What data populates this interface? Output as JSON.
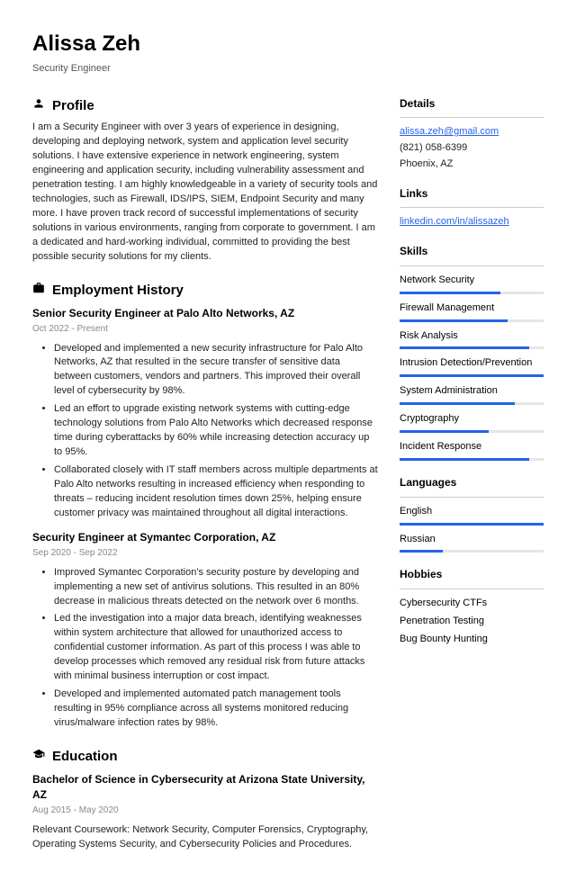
{
  "header": {
    "name": "Alissa Zeh",
    "title": "Security Engineer"
  },
  "sections": {
    "profile_title": "Profile",
    "employment_title": "Employment History",
    "education_title": "Education"
  },
  "profile": "I am a Security Engineer with over 3 years of experience in designing, developing and deploying network, system and application level security solutions. I have extensive experience in network engineering, system engineering and application security, including vulnerability assessment and penetration testing. I am highly knowledgeable in a variety of security tools and technologies, such as Firewall, IDS/IPS, SIEM, Endpoint Security and many more. I have proven track record of successful implementations of security solutions in various environments, ranging from corporate to government. I am a dedicated and hard-working individual, committed to providing the best possible security solutions for my clients.",
  "jobs": [
    {
      "title": "Senior Security Engineer at Palo Alto Networks, AZ",
      "dates": "Oct 2022 - Present",
      "bullets": [
        "Developed and implemented a new security infrastructure for Palo Alto Networks, AZ that resulted in the secure transfer of sensitive data between customers, vendors and partners. This improved their overall level of cybersecurity by 98%.",
        "Led an effort to upgrade existing network systems with cutting-edge technology solutions from Palo Alto Networks which decreased response time during cyberattacks by 60% while increasing detection accuracy up to 95%.",
        "Collaborated closely with IT staff members across multiple departments at Palo Alto networks resulting in increased efficiency when responding to threats – reducing incident resolution times down 25%, helping ensure customer privacy was maintained throughout all digital interactions."
      ]
    },
    {
      "title": "Security Engineer at Symantec Corporation, AZ",
      "dates": "Sep 2020 - Sep 2022",
      "bullets": [
        "Improved Symantec Corporation's security posture by developing and implementing a new set of antivirus solutions. This resulted in an 80% decrease in malicious threats detected on the network over 6 months.",
        "Led the investigation into a major data breach, identifying weaknesses within system architecture that allowed for unauthorized access to confidential customer information. As part of this process I was able to develop processes which removed any residual risk from future attacks with minimal business interruption or cost impact.",
        "Developed and implemented automated patch management tools resulting in 95% compliance across all systems monitored reducing virus/malware infection rates by 98%."
      ]
    }
  ],
  "education": {
    "title": "Bachelor of Science in Cybersecurity at Arizona State University, AZ",
    "dates": "Aug 2015 - May 2020",
    "desc": "Relevant Coursework: Network Security, Computer Forensics, Cryptography, Operating Systems Security, and Cybersecurity Policies and Procedures."
  },
  "side": {
    "details_title": "Details",
    "email": "alissa.zeh@gmail.com",
    "phone": "(821) 058-6399",
    "location": "Phoenix, AZ",
    "links_title": "Links",
    "linkedin": "linkedin.com/in/alissazeh",
    "skills_title": "Skills",
    "skills": [
      {
        "name": "Network Security",
        "pct": 70
      },
      {
        "name": "Firewall Management",
        "pct": 75
      },
      {
        "name": "Risk Analysis",
        "pct": 90
      },
      {
        "name": "Intrusion Detection/Prevention",
        "pct": 100
      },
      {
        "name": "System Administration",
        "pct": 80
      },
      {
        "name": "Cryptography",
        "pct": 62
      },
      {
        "name": "Incident Response",
        "pct": 90
      }
    ],
    "languages_title": "Languages",
    "languages": [
      {
        "name": "English",
        "pct": 100
      },
      {
        "name": "Russian",
        "pct": 30
      }
    ],
    "hobbies_title": "Hobbies",
    "hobbies": [
      "Cybersecurity CTFs",
      "Penetration Testing",
      "Bug Bounty Hunting"
    ]
  }
}
